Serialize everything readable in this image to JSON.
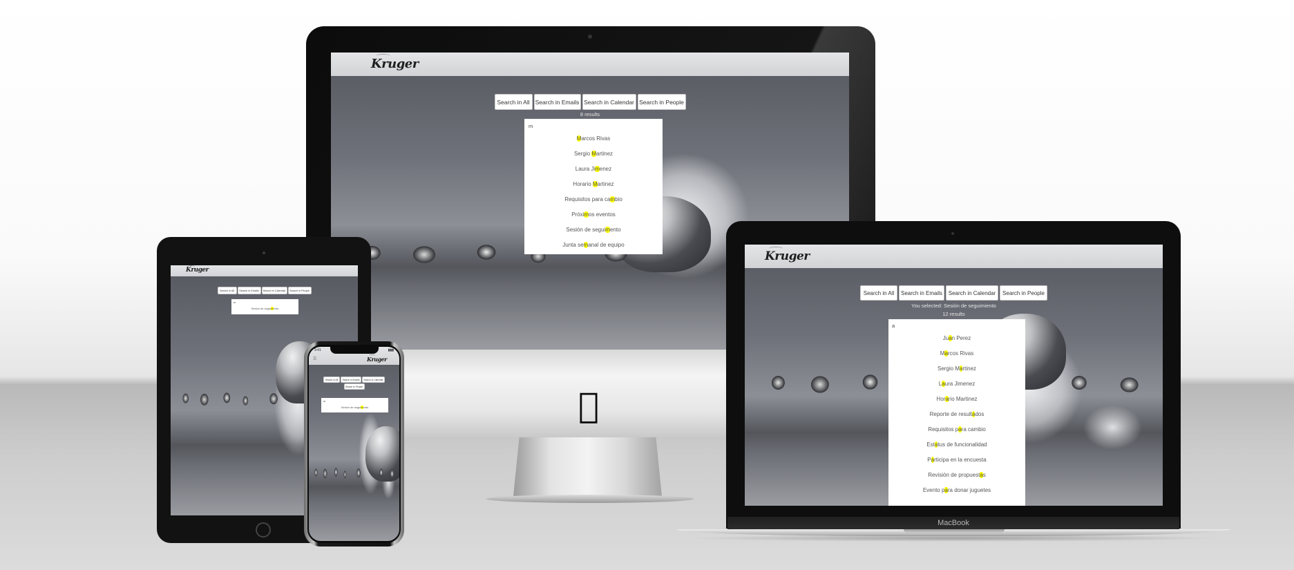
{
  "brand": {
    "logo_text": "Kruger"
  },
  "search_buttons": [
    "Search in All",
    "Search in Emails",
    "Search in Calendar",
    "Search in People"
  ],
  "imac": {
    "results_count": "8 results",
    "query": "m",
    "results": [
      {
        "pre": "",
        "hl": "M",
        "post": "arcos Rivas"
      },
      {
        "pre": "Sergio ",
        "hl": "M",
        "post": "artinez"
      },
      {
        "pre": "Laura Ji",
        "hl": "m",
        "post": "enez"
      },
      {
        "pre": "Horario ",
        "hl": "M",
        "post": "artinez"
      },
      {
        "pre": "Requisitos para ca",
        "hl": "m",
        "post": "bio"
      },
      {
        "pre": "Próxi",
        "hl": "m",
        "post": "os eventos"
      },
      {
        "pre": "Sesión de segui",
        "hl": "m",
        "post": "ento"
      },
      {
        "pre": "Junta se",
        "hl": "m",
        "post": "anal de equipo"
      }
    ]
  },
  "macbook": {
    "selected_text": "You selected: Sesión de seguimiento",
    "results_count": "12 results",
    "query": "a",
    "label": "MacBook",
    "results": [
      {
        "pre": "Ju",
        "hl": "a",
        "post": "n Perez"
      },
      {
        "pre": "M",
        "hl": "a",
        "post": "rcos Rivas"
      },
      {
        "pre": "Sergio M",
        "hl": "a",
        "post": "rtinez"
      },
      {
        "pre": "L",
        "hl": "a",
        "post": "ura Jimenez"
      },
      {
        "pre": "Hor",
        "hl": "a",
        "post": "rio Martinez"
      },
      {
        "pre": "Reporte de result",
        "hl": "a",
        "post": "dos"
      },
      {
        "pre": "Requisitos p",
        "hl": "a",
        "post": "ra cambio"
      },
      {
        "pre": "Est",
        "hl": "a",
        "post": "tus de funcionalidad"
      },
      {
        "pre": "P",
        "hl": "a",
        "post": "rticipa en la encuesta"
      },
      {
        "pre": "Revisión de propuest",
        "hl": "a",
        "post": "s"
      },
      {
        "pre": "Evento p",
        "hl": "a",
        "post": "ra donar juguetes"
      }
    ]
  },
  "ipad": {
    "query": "m",
    "results": [
      {
        "pre": "Sesión de segui",
        "hl": "m",
        "post": "ento"
      }
    ]
  },
  "iphone": {
    "query": "m",
    "status_time": "9:41",
    "menu_icon": "hamburger-menu-icon",
    "results": [
      {
        "pre": "Sesión de segui",
        "hl": "m",
        "post": "ento"
      }
    ]
  },
  "colors": {
    "highlight": "#ffff00",
    "bezel": "#111111"
  }
}
